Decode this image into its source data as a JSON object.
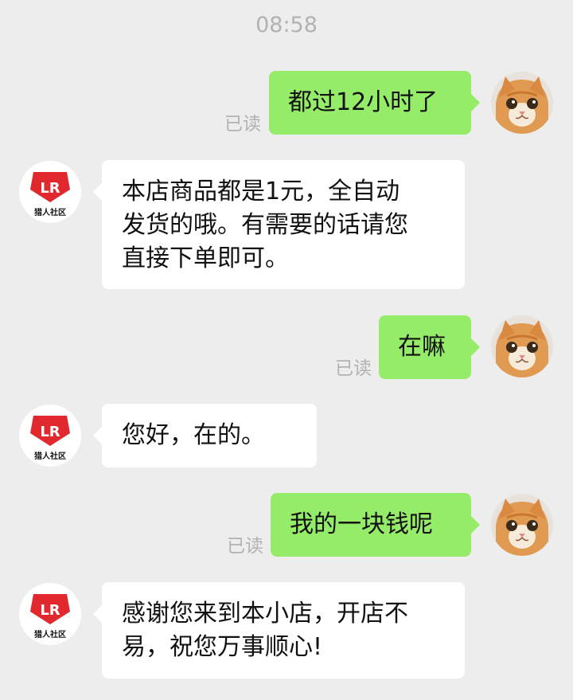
{
  "chat": {
    "timestamp": "08:58",
    "colors": {
      "background": "#ededed",
      "sent_bubble": "#95ec69",
      "received_bubble": "#ffffff",
      "meta_text": "#b2b2b2",
      "shop_logo_red": "#e0282e"
    },
    "shop_avatar": {
      "logo_letters": "LR",
      "caption": "猎人社区"
    },
    "user_avatar": {
      "icon": "cat-avatar-icon"
    },
    "messages": [
      {
        "sender": "me",
        "text": "都过12小时了",
        "status": "已读"
      },
      {
        "sender": "shop",
        "lines": [
          "本店商品都是1元，全自动",
          "发货的哦。有需要的话请您",
          "直接下单即可。"
        ]
      },
      {
        "sender": "me",
        "text": "在嘛",
        "status": "已读"
      },
      {
        "sender": "shop",
        "lines": [
          "您好，在的。"
        ]
      },
      {
        "sender": "me",
        "text": "我的一块钱呢",
        "status": "已读"
      },
      {
        "sender": "shop",
        "lines": [
          "感谢您来到本小店，开店不",
          "易，祝您万事顺心!"
        ]
      }
    ]
  }
}
